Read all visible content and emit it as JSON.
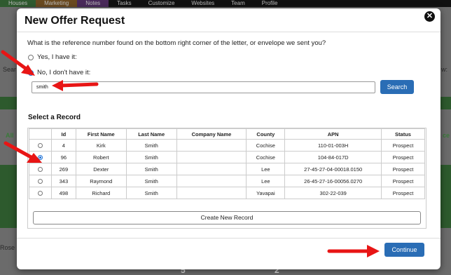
{
  "background": {
    "nav": [
      "Houses",
      "Marketing",
      "Notes",
      "Tasks",
      "Customize",
      "Websites",
      "Team",
      "Profile"
    ],
    "fragments": {
      "left_search": "Sear",
      "right_w": "w:",
      "left_all": "All",
      "right_ce": "ce",
      "left_rose": "Rose",
      "bottom_5": "5",
      "bottom_2": "2"
    }
  },
  "modal": {
    "title": "New Offer Request",
    "close_icon": "close-icon",
    "question": "What is the reference number found on the bottom right corner of the letter, or envelope we sent you?",
    "options": [
      {
        "label": "Yes, I have it:",
        "checked": false
      },
      {
        "label": "No, I don't have it:",
        "checked": true
      }
    ],
    "search": {
      "value": "smith",
      "button": "Search"
    },
    "section_title": "Select a Record",
    "table": {
      "columns": [
        "",
        "Id",
        "First Name",
        "Last Name",
        "Company Name",
        "County",
        "APN",
        "Status"
      ],
      "rows": [
        {
          "selected": false,
          "id": "4",
          "first": "Kirk",
          "last": "Smith",
          "company": "",
          "county": "Cochise",
          "apn": "110-01-003H",
          "status": "Prospect"
        },
        {
          "selected": true,
          "id": "96",
          "first": "Robert",
          "last": "Smith",
          "company": "",
          "county": "Cochise",
          "apn": "104-84-017D",
          "status": "Prospect"
        },
        {
          "selected": false,
          "id": "269",
          "first": "Dexter",
          "last": "Smith",
          "company": "",
          "county": "Lee",
          "apn": "27-45-27-04-00018.0150",
          "status": "Prospect"
        },
        {
          "selected": false,
          "id": "343",
          "first": "Raymond",
          "last": "Smith",
          "company": "",
          "county": "Lee",
          "apn": "26-45-27-16-00056.0270",
          "status": "Prospect"
        },
        {
          "selected": false,
          "id": "498",
          "first": "Richard",
          "last": "Smith",
          "company": "",
          "county": "Yavapai",
          "apn": "302-22-039",
          "status": "Prospect"
        }
      ]
    },
    "create_button": "Create New Record",
    "continue_button": "Continue"
  },
  "colors": {
    "primary": "#2a6db5",
    "arrow": "#e81515",
    "overlay": "#6b6b6b"
  }
}
